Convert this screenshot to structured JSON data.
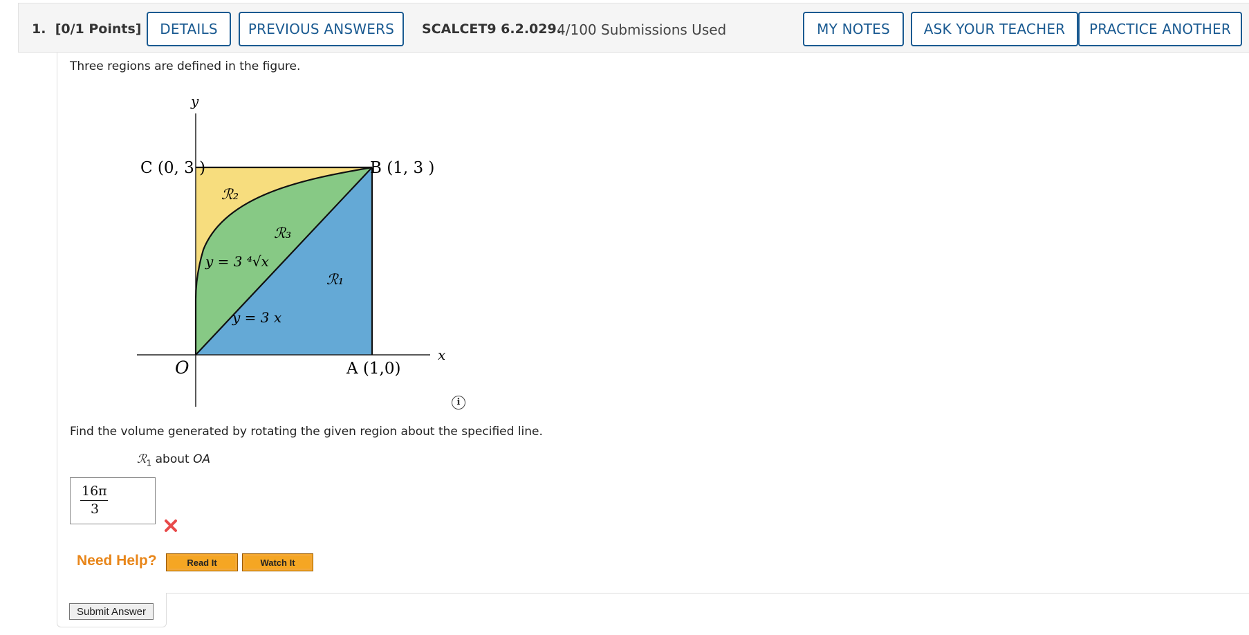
{
  "header": {
    "question_number": "1.",
    "points": "[0/1 Points]",
    "details_label": "DETAILS",
    "previous_answers_label": "PREVIOUS ANSWERS",
    "question_code": "SCALCET9 6.2.029.",
    "submissions": "4/100 Submissions Used",
    "my_notes_label": "MY NOTES",
    "ask_teacher_label": "ASK YOUR TEACHER",
    "practice_another_label": "PRACTICE ANOTHER"
  },
  "question": {
    "intro": "Three regions are defined in the figure.",
    "instruction": "Find the volume generated by rotating the given region about the specified line.",
    "region": "ℛ",
    "region_sub": "1",
    "about_text": "about",
    "axis_line": "OA"
  },
  "figure": {
    "axis_y": "y",
    "axis_x": "x",
    "label_c": "C (0, 3 )",
    "label_b": "B (1, 3 )",
    "label_a": "A (1,0)",
    "label_o": "O",
    "region_1": "ℛ₁",
    "region_2": "ℛ₂",
    "region_3": "ℛ₃",
    "curve_upper": "y = 3 ⁴√x",
    "curve_lower": "y = 3 x",
    "colors": {
      "region_1": "#64a9d6",
      "region_2": "#f7dd7e",
      "region_3": "#87c985"
    }
  },
  "answer": {
    "numerator": "16π",
    "denominator": "3",
    "status": "incorrect",
    "status_icon": "x-mark-icon",
    "status_color": "#e84a4a"
  },
  "help": {
    "label": "Need Help?",
    "read_it": "Read It",
    "watch_it": "Watch It"
  },
  "submit_label": "Submit Answer"
}
